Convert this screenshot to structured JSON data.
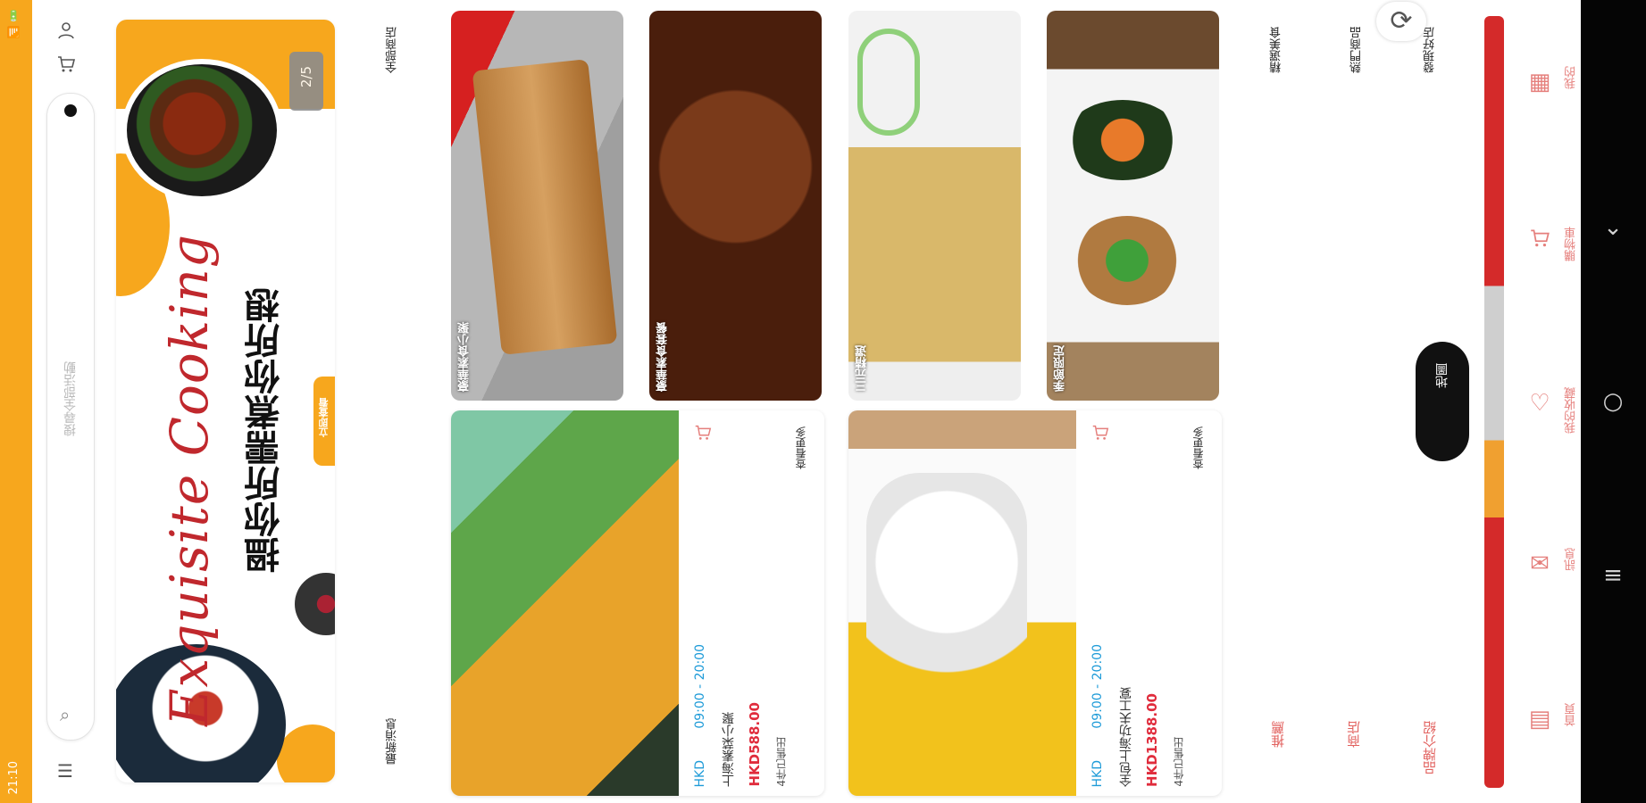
{
  "status_bar": {
    "time": "21:10",
    "icons": "📶 🔋"
  },
  "toolbar": {
    "search_placeholder": "搜尋全部活動",
    "search_icon": "search-icon",
    "cart_icon": "cart-icon",
    "user_icon": "user-icon",
    "menu_icon": "menu-icon"
  },
  "banner": {
    "title_en": "Exquisite Cooking",
    "title_zh": "搵你所需煮你所想",
    "cta": "立即查看",
    "counter": "2/5"
  },
  "sections": {
    "latest": "最新消息",
    "all_shops": "全部商店",
    "featured": "精選美食",
    "popular": "熱門商品",
    "discover": "發現好店",
    "recommend": "推薦",
    "shops": "商店",
    "brands": "品牌介紹"
  },
  "tiles": [
    {
      "caption": "豪華素食小聚",
      "color": "#c9c0b0"
    },
    {
      "caption": "豪華素食套餐",
      "color": "#5a2a16"
    },
    {
      "caption": "三元精選",
      "color": "#d8c07a"
    },
    {
      "caption": "季節限定",
      "color": "#8a6a4a"
    }
  ],
  "cards": [
    {
      "more": "查看更多",
      "name": "上海素菜小聚",
      "price": "HKD588.00",
      "hours": "09:00 - 20:00",
      "currency": "HKD",
      "sold": "4件已售出"
    },
    {
      "more": "查看更多",
      "name": "全包上海功夫工宴",
      "price": "HKD1388.00",
      "hours": "09:00 - 20:00",
      "currency": "HKD",
      "sold": "4件已售出"
    }
  ],
  "map_button": "地圖",
  "refresh_icon": "refresh-icon",
  "tabbar": {
    "items": [
      {
        "label": "首頁",
        "icon": "home-icon"
      },
      {
        "label": "訊息",
        "icon": "mail-icon"
      },
      {
        "label": "我的收藏",
        "icon": "heart-icon"
      },
      {
        "label": "購物車",
        "icon": "cart-icon"
      },
      {
        "label": "我的",
        "icon": "profile-icon"
      }
    ]
  },
  "colors": {
    "brand_orange": "#f7a71d",
    "brand_red": "#d42a2a",
    "price_red": "#e02c3c",
    "time_blue": "#1e9bd8"
  }
}
